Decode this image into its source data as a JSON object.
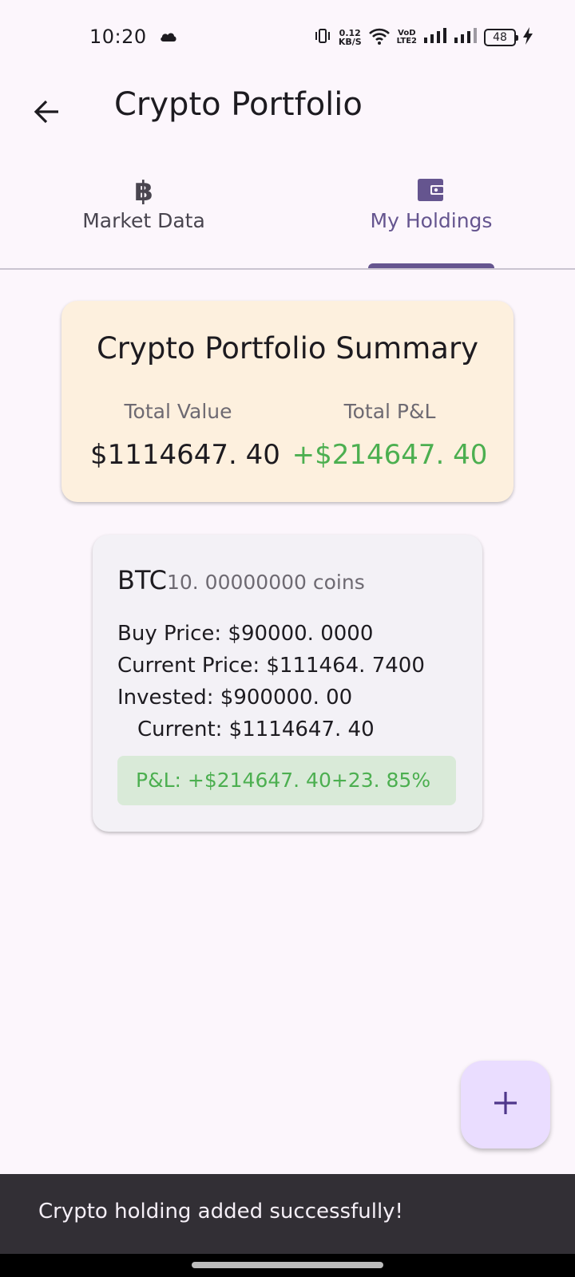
{
  "status_bar": {
    "time": "10:20",
    "net_speed_value": "0.12",
    "net_speed_unit": "KB/S",
    "volte_top": "VoD",
    "volte_bottom": "LTE2",
    "battery": "48",
    "icons": [
      "cloud-icon",
      "vibrate-icon",
      "wifi-icon",
      "signal-icon",
      "signal-icon",
      "battery-icon",
      "charging-bolt-icon"
    ]
  },
  "app_bar": {
    "title": "Crypto Portfolio",
    "back_icon": "arrow-back-icon"
  },
  "tabs": [
    {
      "label": "Market Data",
      "icon": "bitcoin-icon",
      "selected": false
    },
    {
      "label": "My Holdings",
      "icon": "wallet-icon",
      "selected": true
    }
  ],
  "summary": {
    "title": "Crypto Portfolio Summary",
    "total_value_label": "Total Value",
    "total_value": "$1114647. 40",
    "total_pnl_label": "Total P&L",
    "total_pnl": "+$214647. 40"
  },
  "holding": {
    "symbol": "BTC",
    "amount": "10. 00000000 coins",
    "buy_price": "Buy Price: $90000. 0000",
    "current_price": "Current Price: $111464. 7400",
    "invested": "Invested: $900000. 00",
    "current": "Current: $1114647. 40",
    "pnl": "P&L: +$214647. 40+23. 85%"
  },
  "fab": {
    "icon": "add-icon"
  },
  "snackbar": {
    "message": "Crypto holding added successfully!"
  },
  "colors": {
    "background": "#fcf6fc",
    "primary": "#65558f",
    "summary_card": "#fdf0de",
    "holding_card": "#f3f1f6",
    "positive": "#4caf50",
    "pnl_box": "#d9ead8",
    "fab": "#eaddff",
    "snackbar": "#322f35"
  }
}
